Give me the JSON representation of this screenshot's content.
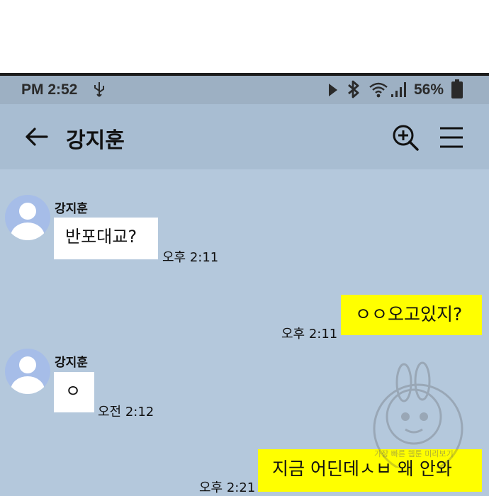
{
  "status_bar": {
    "time": "PM 2:52",
    "battery": "56%",
    "icons": [
      "usb-icon",
      "location-arrow-icon",
      "bluetooth-icon",
      "wifi-icon",
      "signal-icon",
      "battery-icon"
    ]
  },
  "header": {
    "title": "강지훈",
    "icons": [
      "back-arrow-icon",
      "search-zoom-icon",
      "hamburger-menu-icon"
    ]
  },
  "messages": [
    {
      "direction": "incoming",
      "sender": "강지훈",
      "text": "반포대교?",
      "time": "오후 2:11"
    },
    {
      "direction": "outgoing",
      "text": "ㅇㅇ오고있지?",
      "time": "오후 2:11"
    },
    {
      "direction": "incoming",
      "sender": "강지훈",
      "text": "ㅇ",
      "time": "오전 2:12"
    },
    {
      "direction": "outgoing",
      "text": "지금 어딘데ㅅㅂ 왜 안와",
      "time": "오후 2:21"
    }
  ],
  "watermark": {
    "text": "가장 빠른 웹툰 미리보기"
  },
  "colors": {
    "chat_background": "#b4c8dc",
    "app_bar": "#a8bdd2",
    "status_bar": "#9db0c3",
    "outgoing_bubble": "#ffff00",
    "incoming_bubble": "#ffffff",
    "avatar": "#a6bde8"
  }
}
